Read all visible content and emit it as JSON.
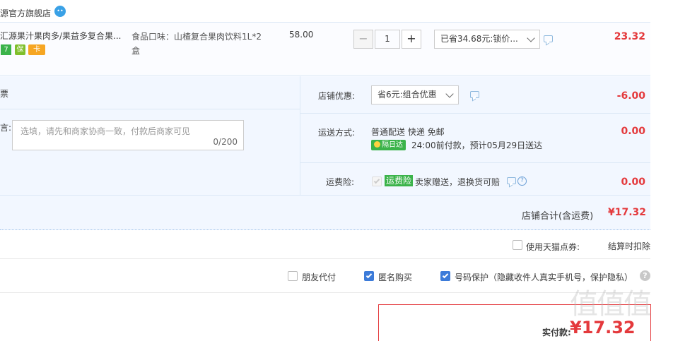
{
  "shop": {
    "name": "源官方旗舰店",
    "wangwang_icon": "wangwang-chat-icon"
  },
  "item": {
    "title": "汇源果汁果肉多/果益多复合果...",
    "badges": [
      "7",
      "保",
      "卡"
    ],
    "sku": "食品口味：山楂复合果肉饮料1L*2盒",
    "unit_price": "58.00",
    "quantity": "1",
    "minus": "−",
    "plus": "+",
    "discount_select": "已省34.68元:锁价...",
    "total": "23.32"
  },
  "info": {
    "invoice_label": "票",
    "message_label": "言:",
    "message_placeholder": "选填，请先和商家协商一致，付款后商家可见",
    "message_count": "0/200",
    "shop_promo_label": "店铺优惠:",
    "shop_promo_select": "省6元:组合优惠",
    "shop_promo_amount": "-6.00",
    "shipping_label": "运送方式:",
    "shipping_method": "普通配送 快递 免邮",
    "next_day_badge": "隔日达",
    "shipping_time": "24:00前付款，预计05月29日送达",
    "shipping_cost": "0.00",
    "insurance_label": "运费险:",
    "insurance_badge": "运费险",
    "insurance_text": "卖家赠送，退换货可赔",
    "insurance_cost": "0.00"
  },
  "shop_total": {
    "label": "店铺合计(含运费)",
    "value": "¥17.32"
  },
  "coupon": {
    "label": "使用天猫点券:",
    "note": "结算时扣除"
  },
  "options": {
    "friend_pay": "朋友代付",
    "anonymous": "匿名购买",
    "number_protect": "号码保护（隐藏收件人真实手机号，保护隐私）",
    "friend_pay_checked": false,
    "anonymous_checked": true,
    "number_protect_checked": true
  },
  "payment": {
    "label": "实付款:",
    "amount": "¥17.32"
  },
  "watermark": "值值值",
  "colors": {
    "price_red": "#e4393c",
    "accent_blue": "#3c7bd9",
    "panel_bg": "#f2f7ff",
    "badge_green": "#3bb34a"
  }
}
